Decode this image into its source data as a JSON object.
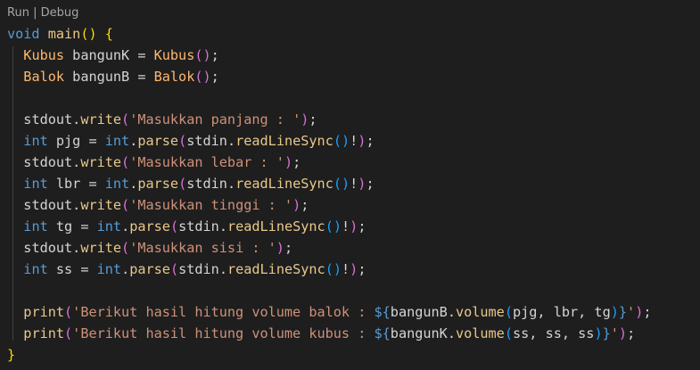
{
  "codelens": {
    "run": "Run",
    "sep": " | ",
    "debug": "Debug"
  },
  "lines": [
    {
      "k": "void",
      "fn": "main",
      "rest": "() {"
    },
    {
      "t1": "Kubus",
      "v": "bangunK",
      "eq": " = ",
      "t2": "Kubus",
      "tail": "();"
    },
    {
      "t1": "Balok",
      "v": "bangunB",
      "eq": " = ",
      "t2": "Balok",
      "tail": "();"
    },
    {
      "obj": "stdout",
      "m": "write",
      "s": "'Masukkan panjang : '"
    },
    {
      "kw": "int",
      "v": "pjg"
    },
    {
      "obj": "stdout",
      "m": "write",
      "s": "'Masukkan lebar : '"
    },
    {
      "kw": "int",
      "v": "lbr"
    },
    {
      "obj": "stdout",
      "m": "write",
      "s": "'Masukkan tinggi : '"
    },
    {
      "kw": "int",
      "v": "tg"
    },
    {
      "obj": "stdout",
      "m": "write",
      "s": "'Masukkan sisi : '"
    },
    {
      "kw": "int",
      "v": "ss"
    },
    {
      "fn": "print",
      "s": "'Berikut hasil hitung volume balok : ",
      "obj": "bangunB",
      "m": "volume",
      "args": "pjg, lbr, tg"
    },
    {
      "fn": "print",
      "s": "'Berikut hasil hitung volume kubus : ",
      "obj": "bangunK",
      "m": "volume",
      "args": "ss, ss, ss"
    }
  ],
  "common": {
    "int_kw": "int",
    "parse": "parse",
    "stdin": "stdin",
    "readline": "readLineSync"
  },
  "colors": {
    "background": "#1e1e1e",
    "keyword": "#569cd6",
    "string": "#ce9178",
    "function": "#e8c88a",
    "type": "#ffb86c",
    "bracket1": "#ffd700",
    "bracket2": "#da70d6",
    "bracket3": "#179fff"
  }
}
